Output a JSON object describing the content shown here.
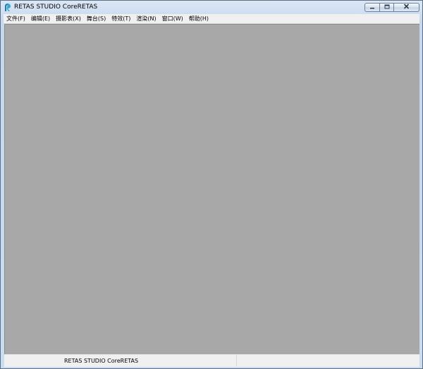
{
  "window": {
    "title": "RETAS STUDIO CoreRETAS",
    "app_icon": "retas-logo-icon"
  },
  "caption_buttons": {
    "minimize_icon": "minimize-icon",
    "maximize_icon": "maximize-icon",
    "close_icon": "close-icon"
  },
  "menu": {
    "items": [
      {
        "label": "文件(F)"
      },
      {
        "label": "编辑(E)"
      },
      {
        "label": "摄影表(X)"
      },
      {
        "label": "舞台(S)"
      },
      {
        "label": "特效(T)"
      },
      {
        "label": "渲染(N)"
      },
      {
        "label": "窗口(W)"
      },
      {
        "label": "帮助(H)"
      }
    ]
  },
  "status_bar": {
    "text": "RETAS STUDIO CoreRETAS"
  },
  "colors": {
    "workspace": "#a8a8a8",
    "menubar": "#f0f0f0",
    "frame": "#c9dcf0"
  }
}
